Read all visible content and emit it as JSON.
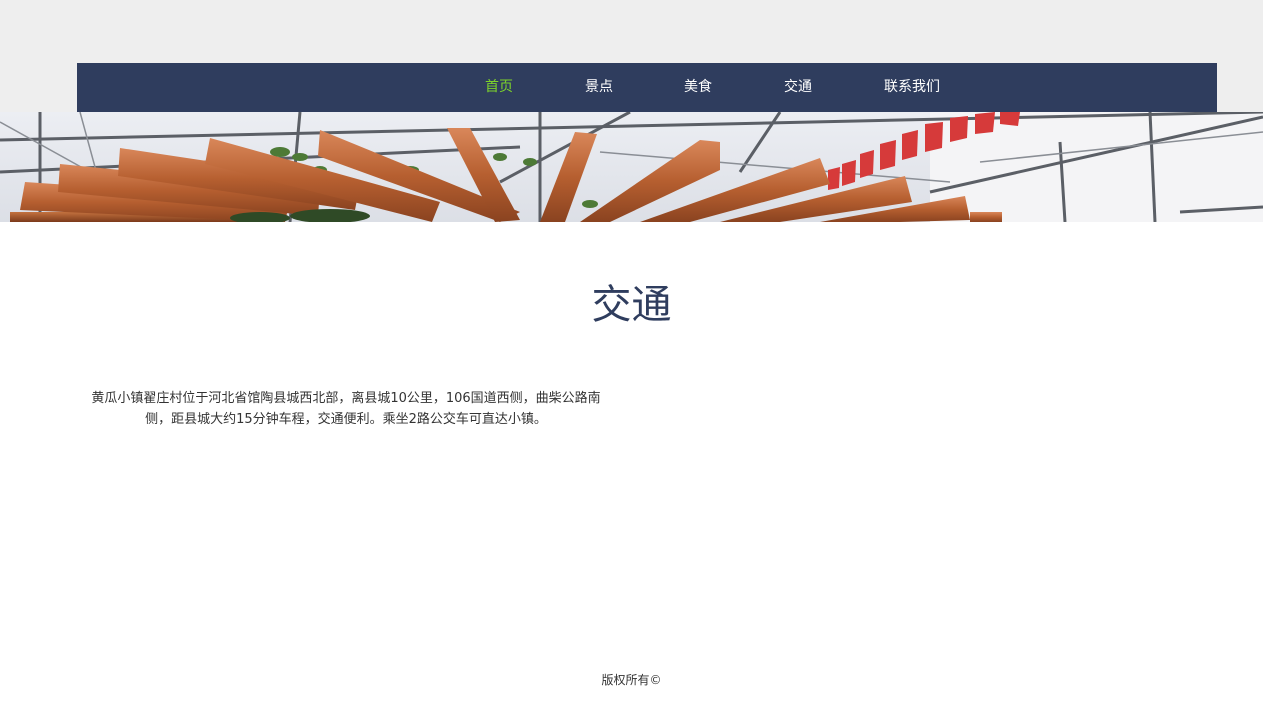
{
  "nav": {
    "items": [
      {
        "label": "首页",
        "active": true
      },
      {
        "label": "景点",
        "active": false
      },
      {
        "label": "美食",
        "active": false
      },
      {
        "label": "交通",
        "active": false
      },
      {
        "label": "联系我们",
        "active": false
      }
    ],
    "active_color": "#7dd32b",
    "bg_color": "#2f3d5e"
  },
  "banner": {
    "image": "greenhouse-wooden-pergola-photo"
  },
  "main": {
    "title": "交通",
    "paragraph": "黄瓜小镇翟庄村位于河北省馆陶县城西北部，离县城10公里，106国道西侧，曲柴公路南侧，距县城大约15分钟车程，交通便利。乘坐2路公交车可直达小镇。"
  },
  "footer": {
    "copyright": "版权所有©"
  }
}
